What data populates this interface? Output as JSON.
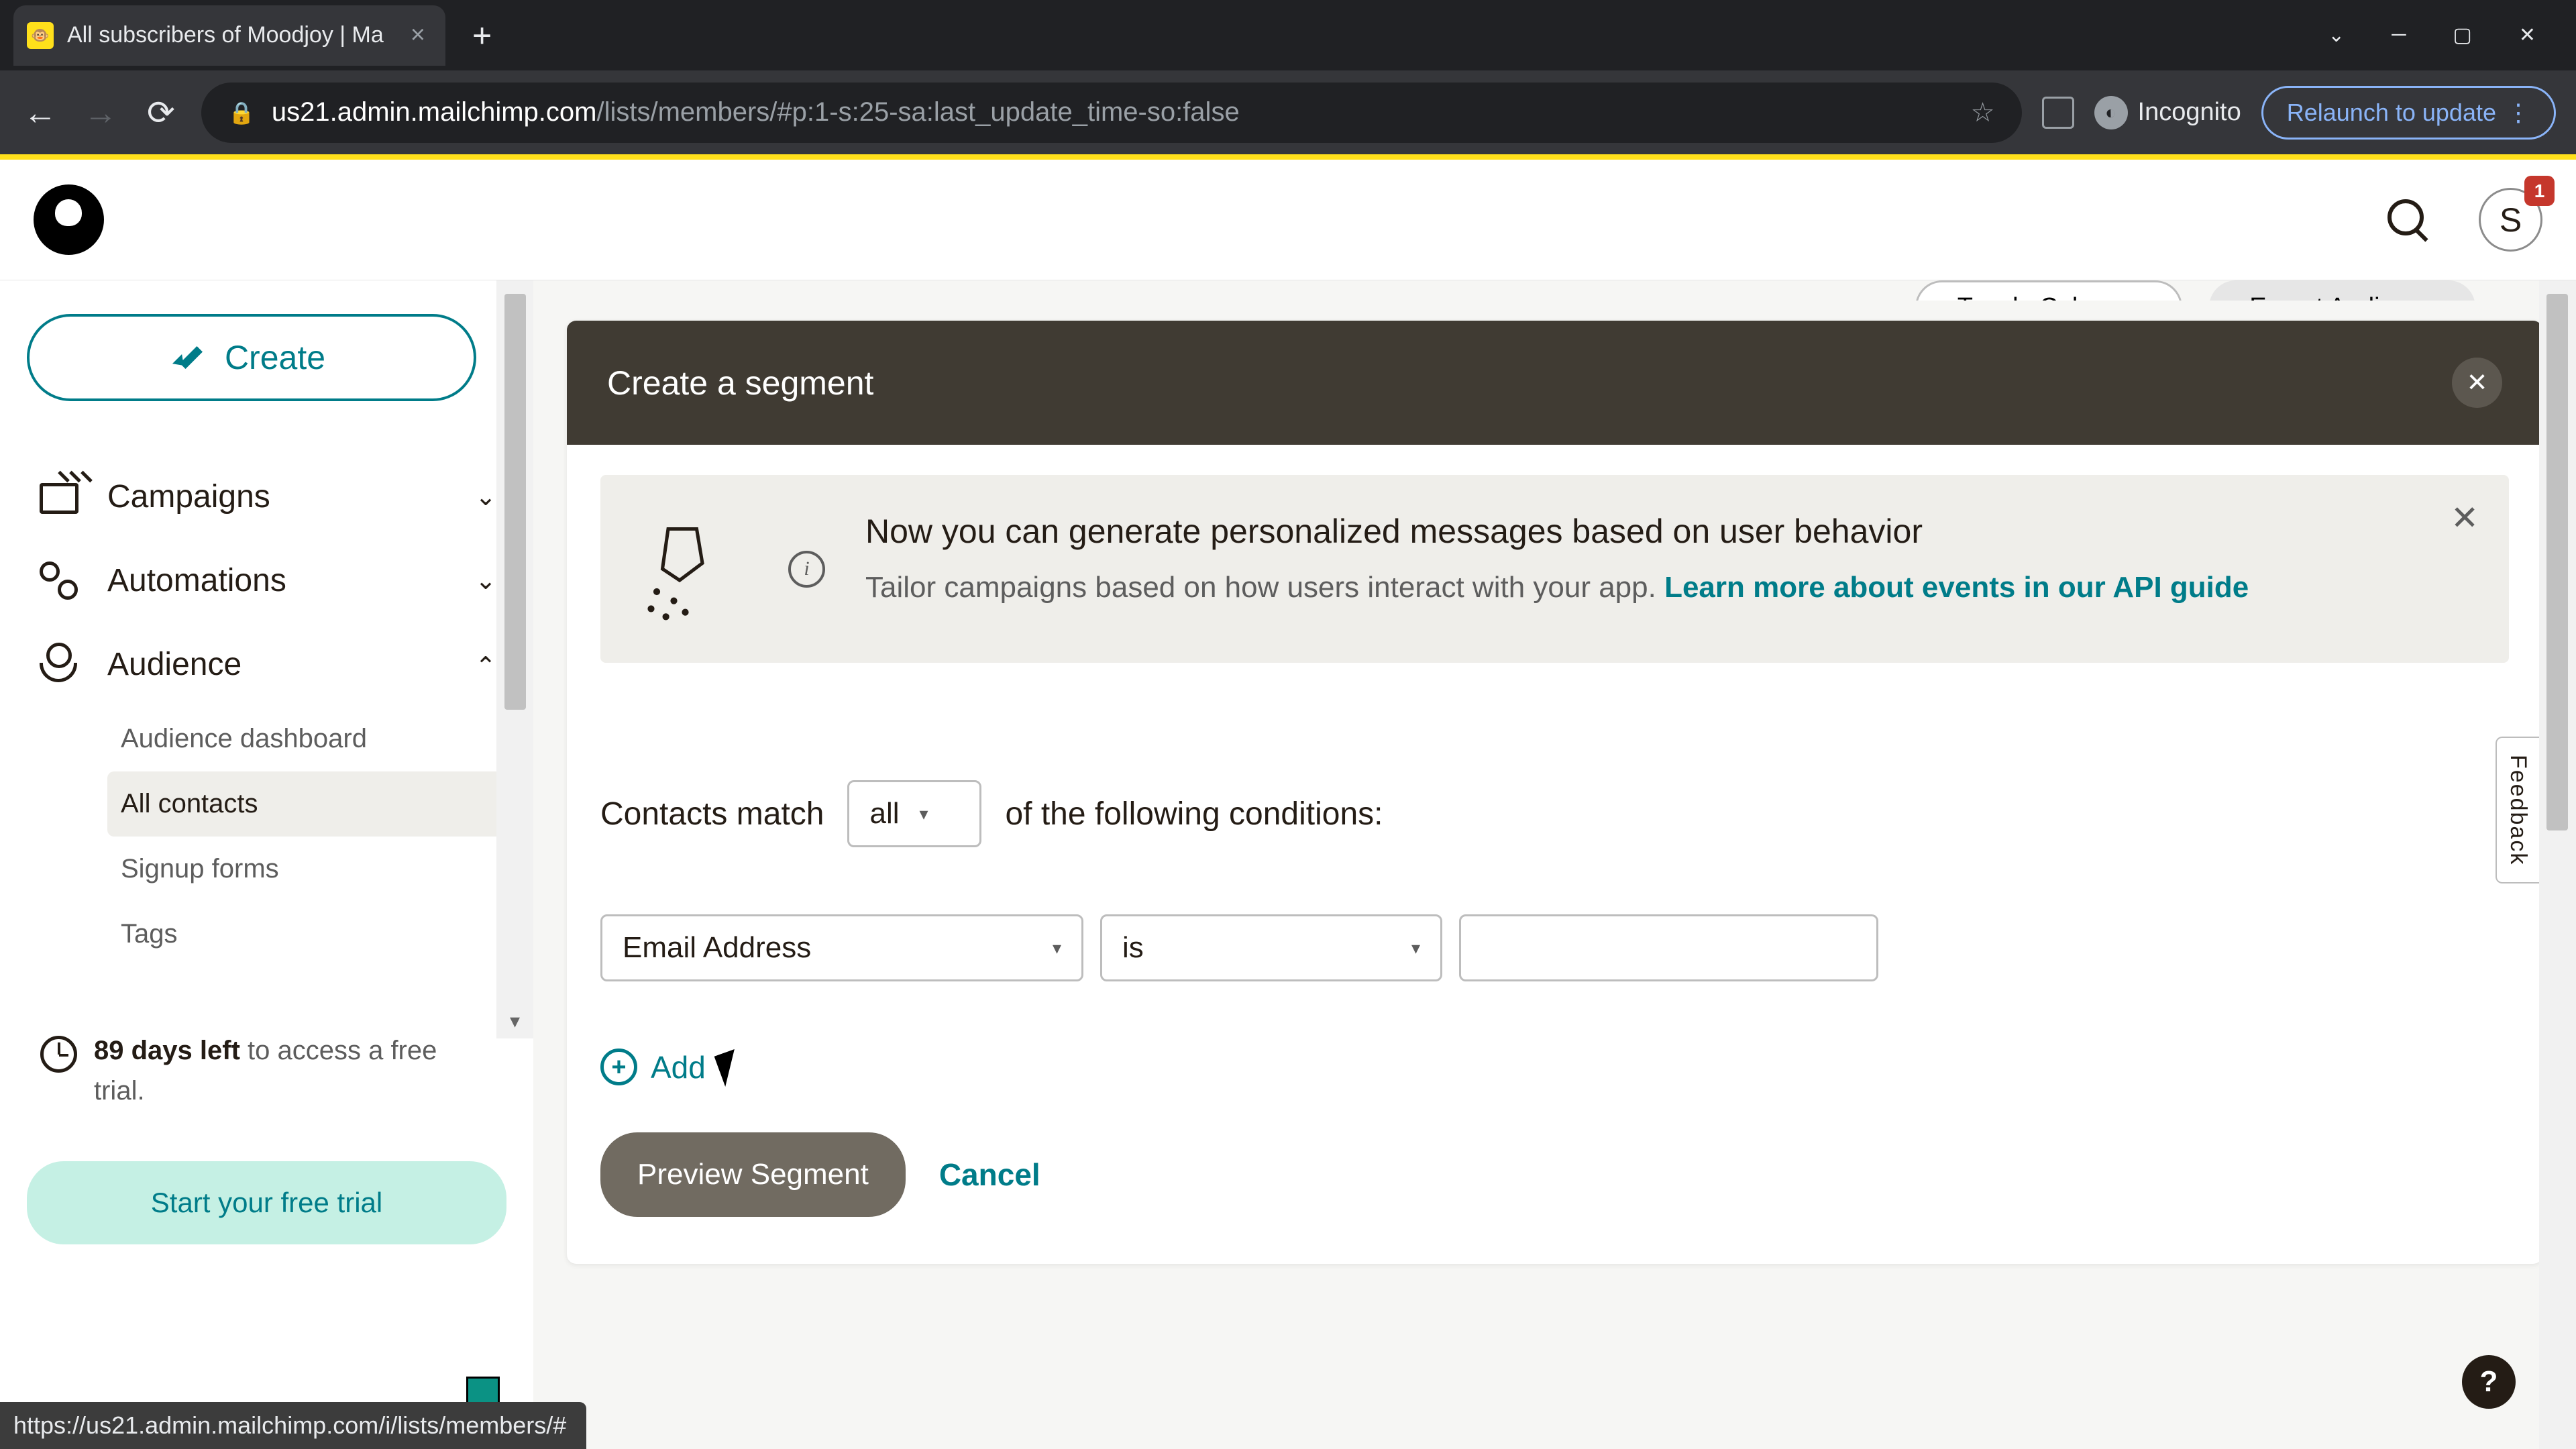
{
  "browser": {
    "tab_title": "All subscribers of Moodjoy | Ma",
    "url_domain": "us21.admin.mailchimp.com",
    "url_path": "/lists/members/#p:1-s:25-sa:last_update_time-so:false",
    "incognito_label": "Incognito",
    "relaunch_label": "Relaunch to update"
  },
  "header": {
    "avatar_letter": "S",
    "notif_count": "1"
  },
  "sidebar": {
    "create_label": "Create",
    "nav": {
      "campaigns": "Campaigns",
      "automations": "Automations",
      "audience": "Audience"
    },
    "audience_sub": {
      "dashboard": "Audience dashboard",
      "all_contacts": "All contacts",
      "signup_forms": "Signup forms",
      "tags": "Tags"
    },
    "trial": {
      "days_bold": "89 days left",
      "days_rest": " to access a free trial.",
      "cta": "Start your free trial"
    }
  },
  "top_buttons": {
    "toggle": "Toggle Columns",
    "export": "Export Audience"
  },
  "panel": {
    "title": "Create a segment",
    "banner_title": "Now you can generate personalized messages based on user behavior",
    "banner_body": "Tailor campaigns based on how users interact with your app. ",
    "banner_link": "Learn more about events in our API guide",
    "match_prefix": "Contacts match",
    "match_value": "all",
    "match_suffix": "of the following conditions:",
    "field_value": "Email Address",
    "op_value": "is",
    "add_label": "Add",
    "preview_label": "Preview Segment",
    "cancel_label": "Cancel"
  },
  "feedback_label": "Feedback",
  "help_label": "?",
  "status_url": "https://us21.admin.mailchimp.com/i/lists/members/#"
}
